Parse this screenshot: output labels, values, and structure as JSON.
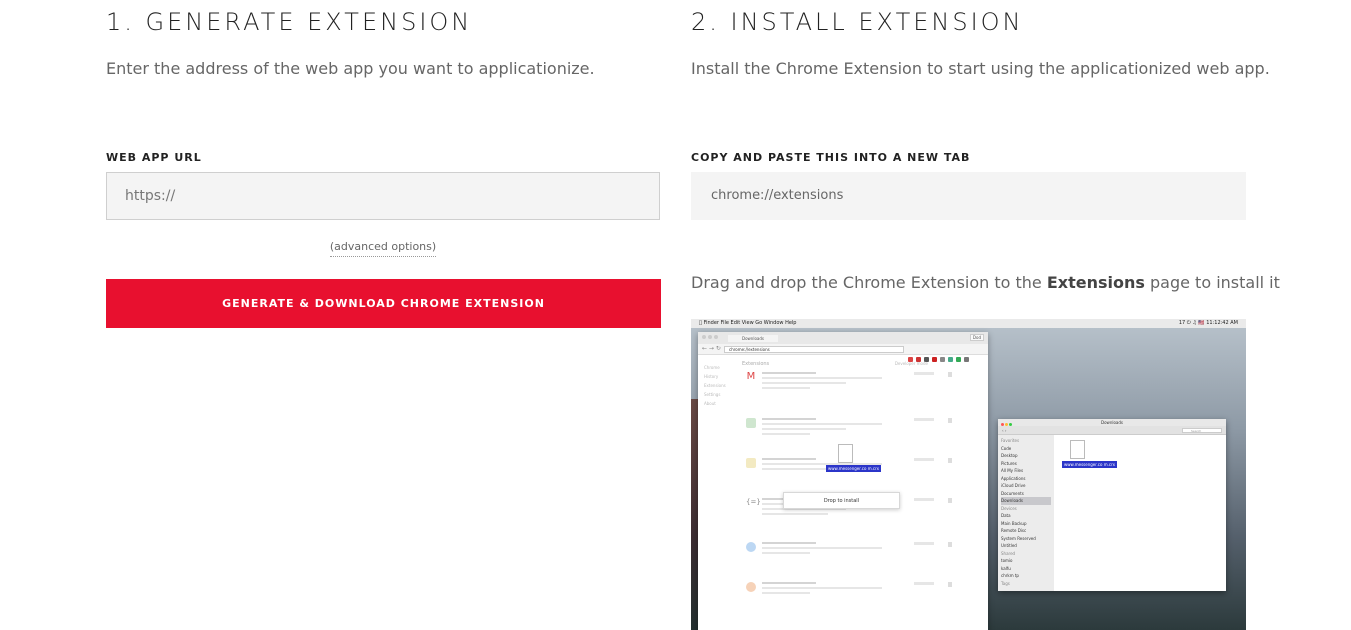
{
  "step1": {
    "title": "1. GENERATE EXTENSION",
    "description": "Enter the address of the web app you want to applicationize.",
    "url_label": "WEB APP URL",
    "url_placeholder": "https://",
    "url_value": "",
    "advanced_link": "(advanced options)",
    "generate_button": "GENERATE & DOWNLOAD CHROME EXTENSION"
  },
  "step2": {
    "title": "2. INSTALL EXTENSION",
    "description": "Install the Chrome Extension to start using the applicationized web app.",
    "copy_label": "COPY AND PASTE THIS INTO A NEW TAB",
    "copy_value": "chrome://extensions",
    "drag_text_before": "Drag and drop the Chrome Extension to the ",
    "drag_text_bold": "Extensions",
    "drag_text_after": " page to install it"
  },
  "demo_image": {
    "menubar_items": "Finder   File   Edit   View   Go   Window   Help",
    "menubar_right": "17 ⏻ ♫ 🇺🇸 11:12:42 AM",
    "chrome_tab": "Downloads",
    "chrome_button": "Dod",
    "chrome_url": "chrome://extensions",
    "ext_sidebar": [
      "Chrome",
      "History",
      "Extensions",
      "Settings",
      "",
      "About"
    ],
    "ext_heading": "Extensions",
    "ext_devmode": "Developer mode",
    "drop_text": "Drop to install",
    "drag_tag": "www.messenger.co m.crx",
    "finder_title": "Downloads",
    "finder_search": "Search",
    "finder_file_tag": "www.messenger.co m.crx",
    "finder_sidebar": [
      {
        "label": "Favorites",
        "header": true
      },
      {
        "label": "Code"
      },
      {
        "label": "Desktop"
      },
      {
        "label": "Pictures"
      },
      {
        "label": "All My Files"
      },
      {
        "label": "Applications"
      },
      {
        "label": "iCloud Drive"
      },
      {
        "label": "Documents"
      },
      {
        "label": "Downloads",
        "selected": true
      },
      {
        "label": "Devices",
        "header": true
      },
      {
        "label": "Data"
      },
      {
        "label": "Main Backup"
      },
      {
        "label": "Remote Disc"
      },
      {
        "label": "System Reserved"
      },
      {
        "label": "Untitled"
      },
      {
        "label": "Shared",
        "header": true
      },
      {
        "label": "tomio"
      },
      {
        "label": "kalfu"
      },
      {
        "label": "chrkm tp"
      },
      {
        "label": "Tags",
        "header": true
      }
    ]
  },
  "colors": {
    "accent": "#e8102f",
    "drag_tag": "#2b35c9"
  }
}
